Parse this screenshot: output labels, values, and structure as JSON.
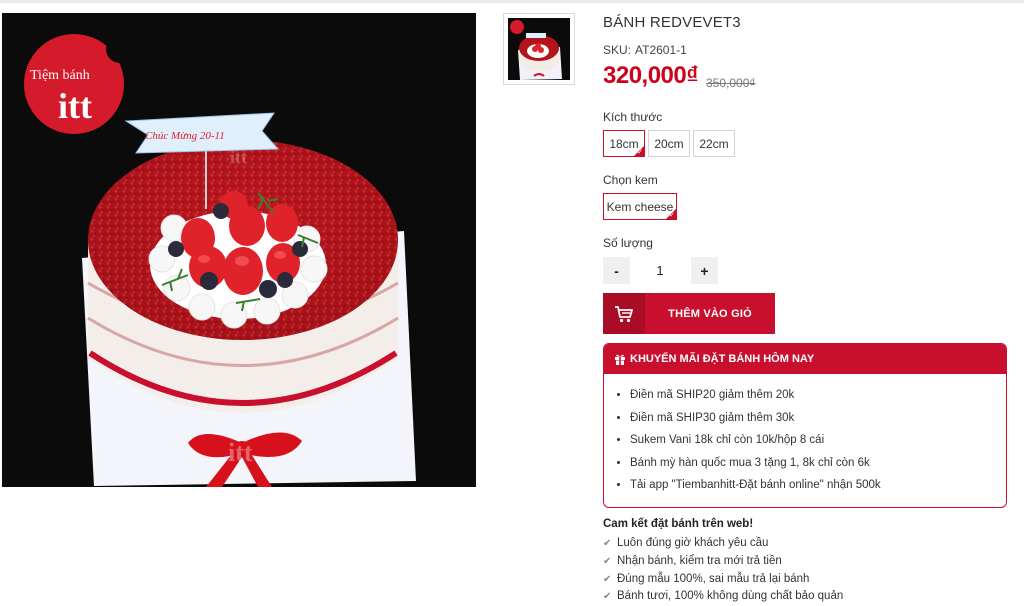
{
  "product": {
    "title": "BÁNH REDVEVET3",
    "sku_label": "SKU:",
    "sku": "AT2601-1",
    "price": "320,000₫",
    "old_price": "350,000₫",
    "image_watermark": "itt",
    "image_alt": "Red velvet cake with strawberries"
  },
  "brand": {
    "logo_line1": "Tiệm bánh",
    "logo_line2": "itt",
    "topper_text": "Chúc Mừng 20-11",
    "accent_color": "#c8102e"
  },
  "size": {
    "label": "Kích thước",
    "options": [
      "18cm",
      "20cm",
      "22cm"
    ],
    "selected": "18cm"
  },
  "cream": {
    "label": "Chọn kem",
    "options": [
      "Kem cheese"
    ],
    "selected": "Kem cheese"
  },
  "quantity": {
    "label": "Số lượng",
    "minus": "-",
    "plus": "+",
    "value": "1"
  },
  "cart": {
    "button_label": "THÊM VÀO GIỎ",
    "icon": "cart-icon"
  },
  "promo": {
    "title": "KHUYẾN MÃI ĐẶT BÁNH HÔM NAY",
    "icon": "gift-icon",
    "items": [
      "Điền mã SHIP20 giảm thêm 20k",
      "Điền mã SHIP30 giảm thêm 30k",
      "Sukem Vani 18k chỉ còn 10k/hộp 8 cái",
      "Bánh mỳ hàn quốc mua 3 tặng 1, 8k chỉ còn 6k",
      "Tải app \"Tiembanhitt-Đặt bánh online\" nhận 500k"
    ]
  },
  "commitment": {
    "title": "Cam kết đặt bánh trên web!",
    "icon": "check-icon",
    "items": [
      "Luôn đúng giờ khách yêu cầu",
      "Nhận bánh, kiểm tra mới trả tiền",
      "Đúng mẫu 100%, sai mẫu trả lại bánh",
      "Bánh tươi, 100% không dùng chất bảo quản"
    ]
  }
}
